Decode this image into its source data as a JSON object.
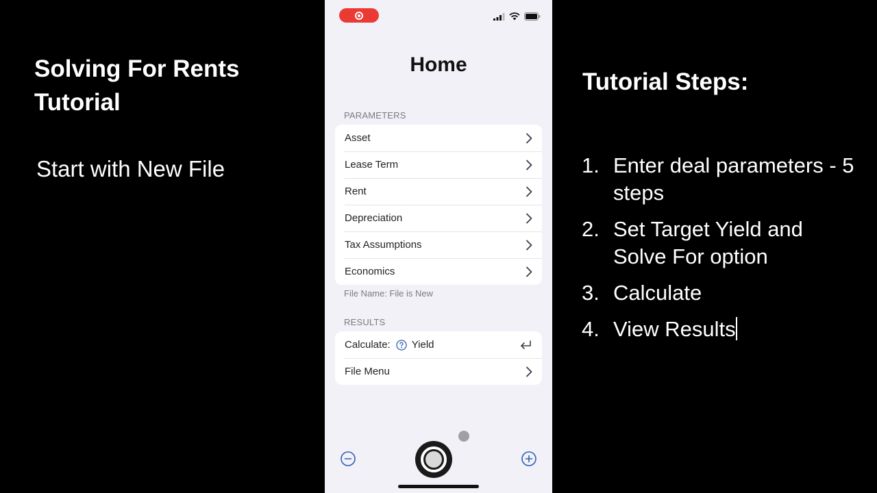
{
  "left": {
    "title": "Solving For Rents Tutorial",
    "subtitle": "Start with New File"
  },
  "right": {
    "title": "Tutorial Steps:",
    "steps": [
      {
        "num": "1.",
        "text": "Enter deal parameters - 5 steps"
      },
      {
        "num": "2.",
        "text": "Set Target Yield and Solve For option"
      },
      {
        "num": "3.",
        "text": "Calculate"
      },
      {
        "num": "4.",
        "text": "View Results"
      }
    ]
  },
  "phone": {
    "colors": {
      "accent": "#2f5fb3",
      "record": "#ea3a33",
      "background": "#f2f1f7"
    },
    "title": "Home",
    "parameters": {
      "header": "PARAMETERS",
      "items": [
        {
          "label": "Asset",
          "icon": "chevron-right-icon"
        },
        {
          "label": "Lease Term",
          "icon": "chevron-right-icon"
        },
        {
          "label": "Rent",
          "icon": "chevron-right-icon"
        },
        {
          "label": "Depreciation",
          "icon": "chevron-right-icon"
        },
        {
          "label": "Tax Assumptions",
          "icon": "chevron-right-icon"
        },
        {
          "label": "Economics",
          "icon": "chevron-right-icon"
        }
      ],
      "footer": "File Name: File is New"
    },
    "results": {
      "header": "RESULTS",
      "calculate_label": "Calculate:",
      "calculate_value": "Yield",
      "file_menu": "File Menu"
    }
  }
}
